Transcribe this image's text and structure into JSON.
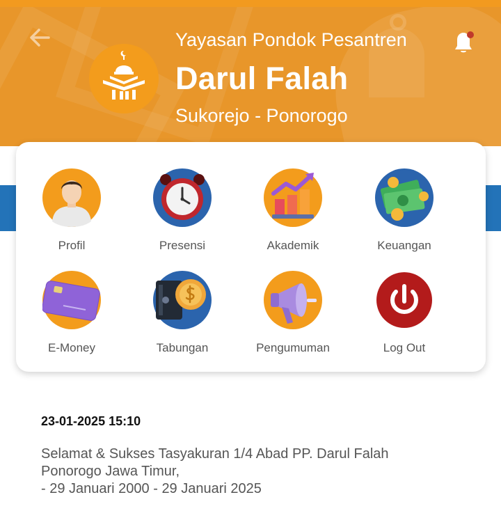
{
  "header": {
    "subtitle": "Yayasan Pondok Pesantren",
    "title": "Darul Falah",
    "location": "Sukorejo - Ponorogo",
    "notification_dot": true
  },
  "menu": [
    {
      "label": "Profil",
      "icon": "profile-icon"
    },
    {
      "label": "Presensi",
      "icon": "alarm-clock-icon"
    },
    {
      "label": "Akademik",
      "icon": "bar-chart-icon"
    },
    {
      "label": "Keuangan",
      "icon": "money-icon"
    },
    {
      "label": "E-Money",
      "icon": "card-icon"
    },
    {
      "label": "Tabungan",
      "icon": "safe-coin-icon"
    },
    {
      "label": "Pengumuman",
      "icon": "megaphone-icon"
    },
    {
      "label": "Log Out",
      "icon": "power-icon"
    }
  ],
  "news": {
    "timestamp": "23-01-2025 15:10",
    "lines": [
      "Selamat & Sukses Tasyakuran 1/4 Abad PP. Darul Falah",
      "Ponorogo Jawa Timur,",
      "- 29 Januari 2000 - 29 Januari 2025"
    ]
  },
  "colors": {
    "header_orange": "#e8962a",
    "accent_blue": "#2373b8",
    "logout_red": "#b31b1b",
    "icon_orange": "#f39c1c"
  }
}
